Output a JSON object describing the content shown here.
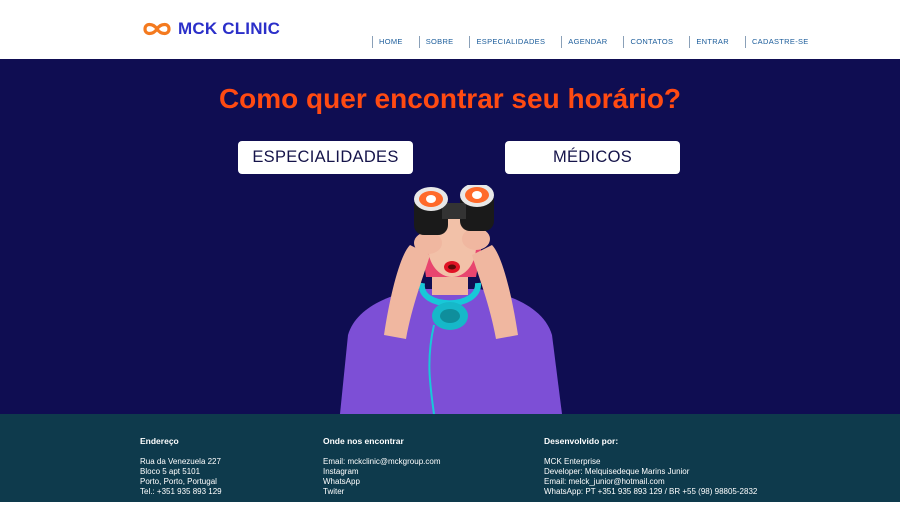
{
  "brand": {
    "name": "MCK CLINIC",
    "logo_icon": "infinity-icon",
    "logo_color": "#f47a1f",
    "text_color": "#2b2fc9"
  },
  "nav": {
    "items": [
      "HOME",
      "SOBRE",
      "ESPECIALIDADES",
      "AGENDAR",
      "CONTATOS",
      "ENTRAR",
      "CADASTRE-SE"
    ]
  },
  "hero": {
    "title": "Como quer encontrar seu horário?",
    "buttons": {
      "especialidades": "ESPECIALIDADES",
      "medicos": "MÉDICOS"
    },
    "background": "#0f0d52",
    "accent": "#ff4a12"
  },
  "footer": {
    "address": {
      "title": "Endereço",
      "lines": [
        "Rua da Venezuela 227",
        "Bloco 5 apt 5101",
        "Porto, Porto, Portugal",
        "Tel.: +351 935 893 129"
      ]
    },
    "find": {
      "title": "Onde nos encontrar",
      "lines": [
        "Email: mckclinic@mckgroup.com",
        "Instagram",
        "WhatsApp",
        "Twiter"
      ]
    },
    "dev": {
      "title": "Desenvolvido por:",
      "lines": [
        "MCK Enterprise",
        "Developer: Melquisedeque Marins Junior",
        "Email: melck_junior@hotmail.com",
        "WhatsApp: PT +351 935 893 129 / BR +55 (98) 98805-2832"
      ]
    },
    "background": "#0e3a4c"
  }
}
